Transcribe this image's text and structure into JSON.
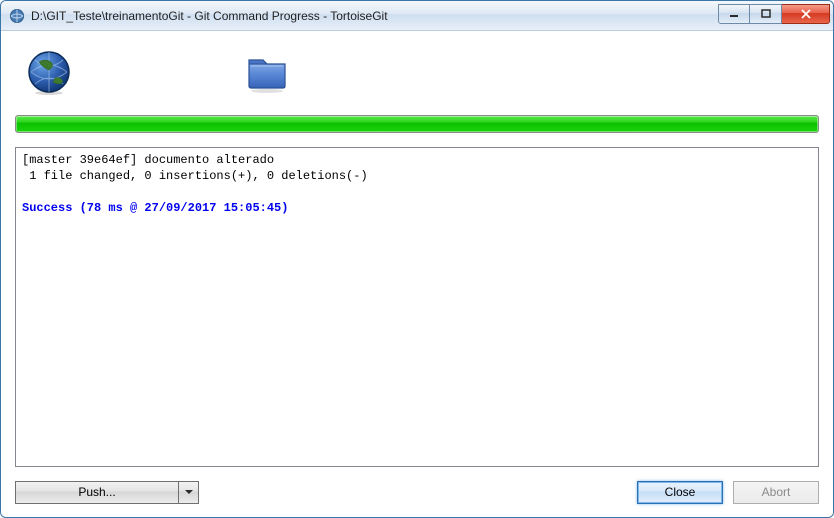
{
  "window": {
    "title": "D:\\GIT_Teste\\treinamentoGit - Git Command Progress - TortoiseGit"
  },
  "output": {
    "line1": "[master 39e64ef] documento alterado",
    "line2": " 1 file changed, 0 insertions(+), 0 deletions(-)",
    "blank": "",
    "success": "Success (78 ms @ 27/09/2017 15:05:45)"
  },
  "buttons": {
    "push": "Push...",
    "close": "Close",
    "abort": "Abort"
  },
  "icons": {
    "globe": "globe-icon",
    "folder": "folder-icon"
  }
}
